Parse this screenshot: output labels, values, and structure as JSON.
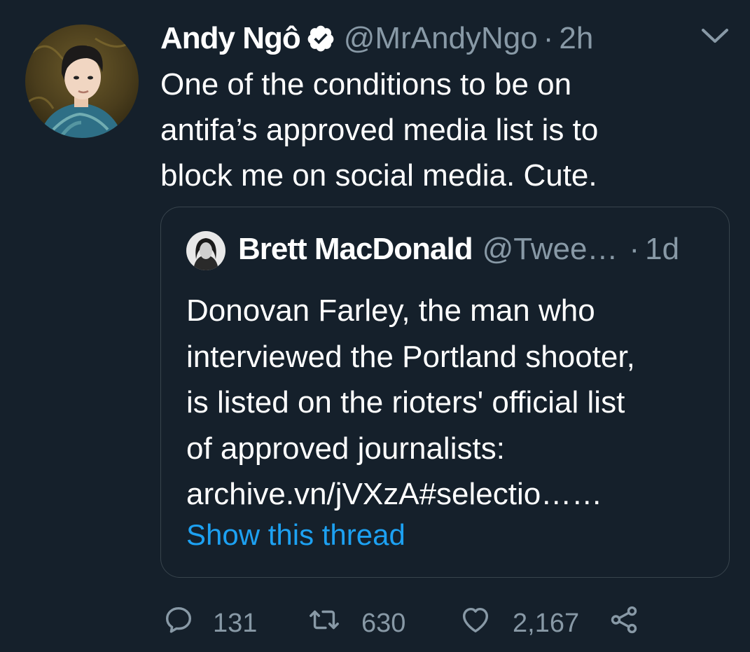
{
  "tweet": {
    "author_name": "Andy Ngô",
    "verified": true,
    "handle": "@MrAndyNgo",
    "separator": "·",
    "time": "2h",
    "text_lines": [
      "One of the conditions to be on",
      "antifa’s approved media list is to",
      "block me on social media. Cute."
    ]
  },
  "quoted_tweet": {
    "author_name": "Brett MacDonald",
    "handle": "@Twee…",
    "separator": "·",
    "time": "1d",
    "text_lines": [
      "Donovan Farley, the man who",
      "interviewed the Portland shooter,",
      "is listed on the rioters' official list",
      "of approved journalists:",
      "archive.vn/jVXzA#selectio……"
    ],
    "show_thread_label": "Show this thread"
  },
  "actions": {
    "reply": {
      "icon": "reply-icon",
      "count": "131"
    },
    "retweet": {
      "icon": "retweet-icon",
      "count": "630"
    },
    "like": {
      "icon": "heart-icon",
      "count": "2,167"
    },
    "share": {
      "icon": "share-icon"
    }
  },
  "colors": {
    "background": "#15202b",
    "primary_text": "#ffffff",
    "secondary_text": "#8899a6",
    "link": "#1da1f2",
    "border": "#38444d"
  }
}
